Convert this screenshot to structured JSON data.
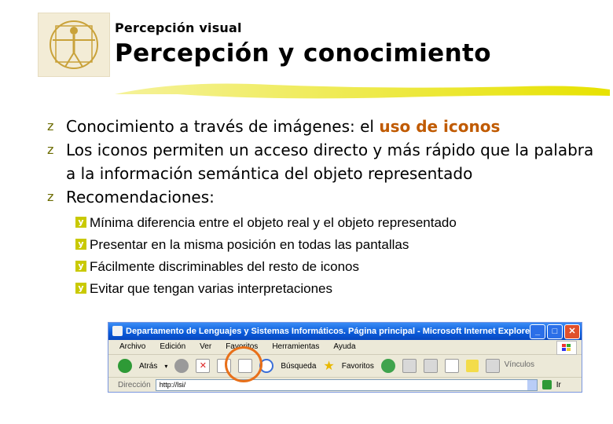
{
  "header": {
    "kicker": "Percepción visual",
    "title": "Percepción y conocimiento"
  },
  "bullets": [
    {
      "pre": "Conocimiento a través de imágenes: el ",
      "highlight": "uso de iconos"
    },
    {
      "text": "Los iconos permiten un acceso directo y más rápido que la palabra a la información semántica del objeto representado"
    },
    {
      "text": "Recomendaciones:"
    }
  ],
  "recommendations": [
    "Mínima diferencia entre el objeto real y el objeto representado",
    "Presentar en la misma posición en todas las pantallas",
    "Fácilmente discriminables del resto de iconos",
    "Evitar que tengan varias interpretaciones"
  ],
  "bullet_glyphs": {
    "main": "z",
    "sub": "y"
  },
  "browser": {
    "title": "Departamento de Lenguajes y Sistemas Informáticos. Página principal - Microsoft Internet Explorer",
    "menu": [
      "Archivo",
      "Edición",
      "Ver",
      "Favoritos",
      "Herramientas",
      "Ayuda"
    ],
    "toolbar": {
      "back": "Atrás",
      "search": "Búsqueda",
      "favorites": "Favoritos"
    },
    "links_label": "Vínculos",
    "address_label": "Dirección",
    "address_value": "http://lsi/",
    "go_label": "Ir"
  },
  "colors": {
    "highlight": "#c05a00",
    "circle": "#e8701a",
    "sub_bullet": "#c9c900"
  }
}
